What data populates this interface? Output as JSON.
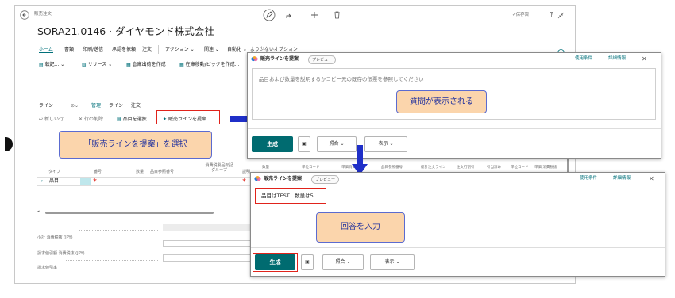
{
  "main": {
    "breadcrumb": "販売注文",
    "title": "SORA21.0146 · ダイヤモンド株式会社",
    "saved_label": "✓保存済",
    "actions": {
      "home": "ホーム",
      "doc": "書類",
      "print": "印刷/送信",
      "release": "承認を依頼",
      "order": "注文",
      "action": "アクション",
      "related": "関連",
      "auto": "自動化",
      "fewer": "より少ないオプション"
    },
    "toolbar2": {
      "post": "転記...",
      "release": "リリース",
      "warehouse_ship": "倉庫出荷を作成",
      "warehouse_pick": "在庫移動/ピックを作成..."
    },
    "lines": {
      "tab_lines": "ライン",
      "manage": "管理",
      "line": "ライン",
      "order": "注文",
      "new_line": "新しい行",
      "delete_line": "行の削除",
      "select_items": "品目を選択...",
      "suggest_lines": "販売ラインを提案"
    },
    "grid": {
      "headers": [
        "タイプ",
        "番号",
        "数量",
        "品目参照番号",
        "消費税製品転記グループ",
        "説明"
      ],
      "row_type": "品目",
      "required_mark": "*"
    },
    "totals": [
      {
        "label": "小計 消費税抜 (JPY)"
      },
      {
        "label": "請求値引額 消費税抜 (JPY)"
      },
      {
        "label": "請求値引率"
      }
    ]
  },
  "dialog1": {
    "title": "販売ラインを提案",
    "badge": "プレビュー",
    "terms": "使用条件",
    "details": "詳細情報",
    "placeholder": "品目および数量を説明するかコピー元の既存の伝票を参照してください",
    "generate": "生成",
    "match": "照合",
    "view": "表示"
  },
  "dialog2": {
    "title": "販売ラインを提案",
    "badge": "プレビュー",
    "terms": "使用条件",
    "details": "詳細情報",
    "prompt_text": "品目はTEST　数量は5",
    "generate": "生成",
    "match": "照合",
    "view": "表示",
    "bg_headers": [
      "数量",
      "単位コード",
      "単価消費税抜",
      "品目参照番号",
      "総計注文ライン",
      "注文行割引",
      "引当済み",
      "単位コード",
      "単価 消費税抜"
    ]
  },
  "callouts": {
    "select": "「販売ラインを提案」を選択",
    "question": "質問が表示される",
    "answer": "回答を入力"
  },
  "colors": {
    "accent": "#00707a",
    "callout_bg": "#fbd5ac",
    "arrow": "#1f2fc8",
    "highlight": "#e0231b"
  }
}
